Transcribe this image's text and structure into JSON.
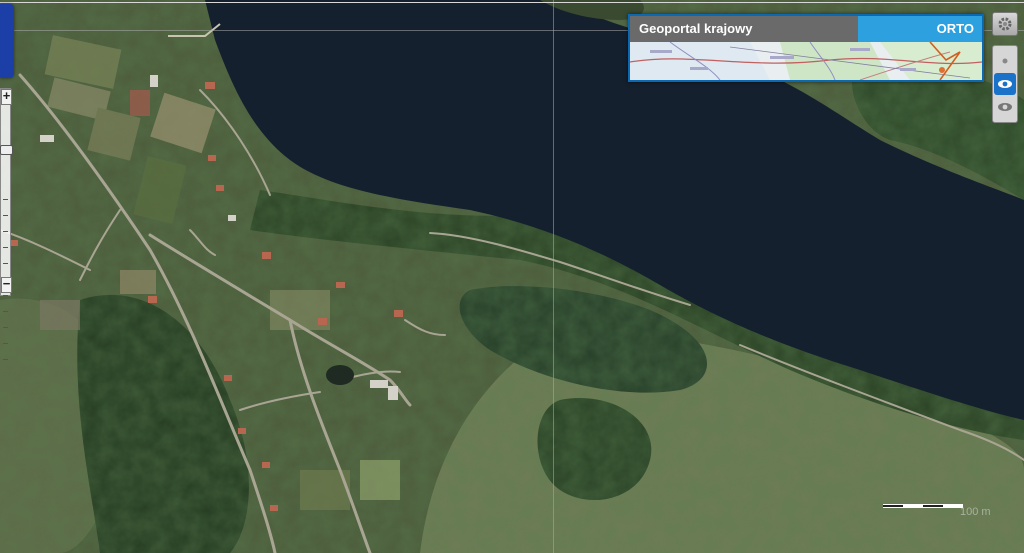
{
  "map": {
    "type": "orthophoto",
    "colors": {
      "water": "#15202e",
      "land": "#4a5a3a",
      "forest": "#243a22",
      "meadow": "#6c7a52",
      "road": "#b0aa98"
    }
  },
  "layer_switcher": {
    "title": "Geoportal krajowy",
    "active_layer": "ORTO"
  },
  "controls": {
    "zoom_in_label": "+",
    "zoom_out_label": "−",
    "gear_icon": "gear-icon",
    "visibility_icons": [
      "dot-icon",
      "eye-icon",
      "eye-icon"
    ]
  },
  "scale": {
    "label": "100 m"
  }
}
